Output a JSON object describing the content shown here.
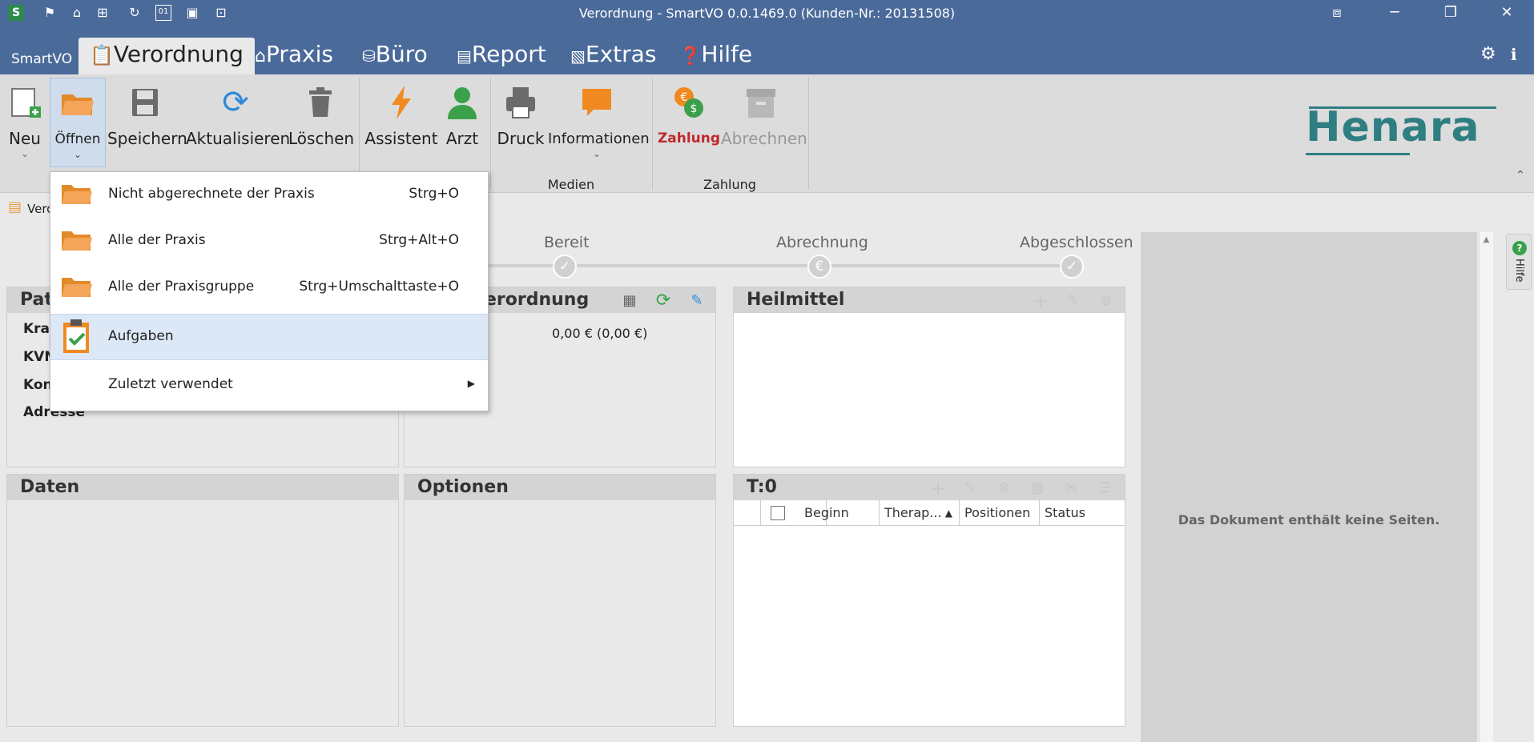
{
  "window": {
    "title": "Verordnung - SmartVO 0.0.1469.0 (Kunden-Nr.: 20131508)",
    "app_badge": "S"
  },
  "tabs": {
    "app_label": "SmartVO",
    "items": [
      {
        "label": "Verordnung",
        "icon": "clipboard-icon",
        "active": true
      },
      {
        "label": "Praxis",
        "icon": "home-icon"
      },
      {
        "label": "Büro",
        "icon": "coins-icon"
      },
      {
        "label": "Report",
        "icon": "clipboard-icon"
      },
      {
        "label": "Extras",
        "icon": "document-search-icon"
      },
      {
        "label": "Hilfe",
        "icon": "help-icon"
      }
    ]
  },
  "ribbon": {
    "buttons": {
      "neu": "Neu",
      "oeffnen": "Öffnen",
      "speichern": "Speichern",
      "aktualisieren": "Aktualisieren",
      "loeschen": "Löschen",
      "assistent": "Assistent",
      "arzt": "Arzt",
      "druck": "Druck",
      "informationen": "Informationen",
      "zahlung": "Zahlung",
      "abrechnen": "Abrechnen"
    },
    "groups": {
      "medien": "Medien",
      "zahlung": "Zahlung"
    },
    "logo": "Henara"
  },
  "breadcrumb": {
    "label": "Vero"
  },
  "status": {
    "stages": [
      "Bereit",
      "Abrechnung",
      "Abgeschlossen"
    ]
  },
  "panels": {
    "patient": {
      "title": "Pat",
      "fields": [
        "Kran",
        "KVN",
        "Kont",
        "Adresse"
      ]
    },
    "verordnung": {
      "title": "erordnung",
      "amount": "0,00 € (0,00 €)"
    },
    "heilmittel": {
      "title": "Heilmittel"
    },
    "daten": {
      "title": "Daten"
    },
    "optionen": {
      "title": "Optionen"
    },
    "termine": {
      "title": "T:0",
      "columns": [
        "Beginn",
        "Therap...",
        "Positionen",
        "Status"
      ]
    }
  },
  "document_viewer": {
    "message": "Das Dokument enthält keine Seiten.",
    "help_tab": "Hilfe"
  },
  "dropdown": {
    "items": [
      {
        "label": "Nicht abgerechnete der Praxis",
        "shortcut": "Strg+O",
        "icon": "folder-icon"
      },
      {
        "label": "Alle der Praxis",
        "shortcut": "Strg+Alt+O",
        "icon": "folder-icon"
      },
      {
        "label": "Alle der Praxisgruppe",
        "shortcut": "Strg+Umschalttaste+O",
        "icon": "folder-icon"
      },
      {
        "label": "Aufgaben",
        "shortcut": "",
        "icon": "tasks-icon",
        "highlighted": true
      },
      {
        "label": "Zuletzt verwendet",
        "shortcut": "",
        "icon": "",
        "submenu": true
      }
    ]
  },
  "colors": {
    "titlebar": "#4a6a9a",
    "accent_orange": "#f0a048",
    "refresh_blue": "#2f8ad8",
    "green": "#3aa14a",
    "zahlung_red": "#c0282d",
    "logo_teal": "#2f7e82"
  }
}
